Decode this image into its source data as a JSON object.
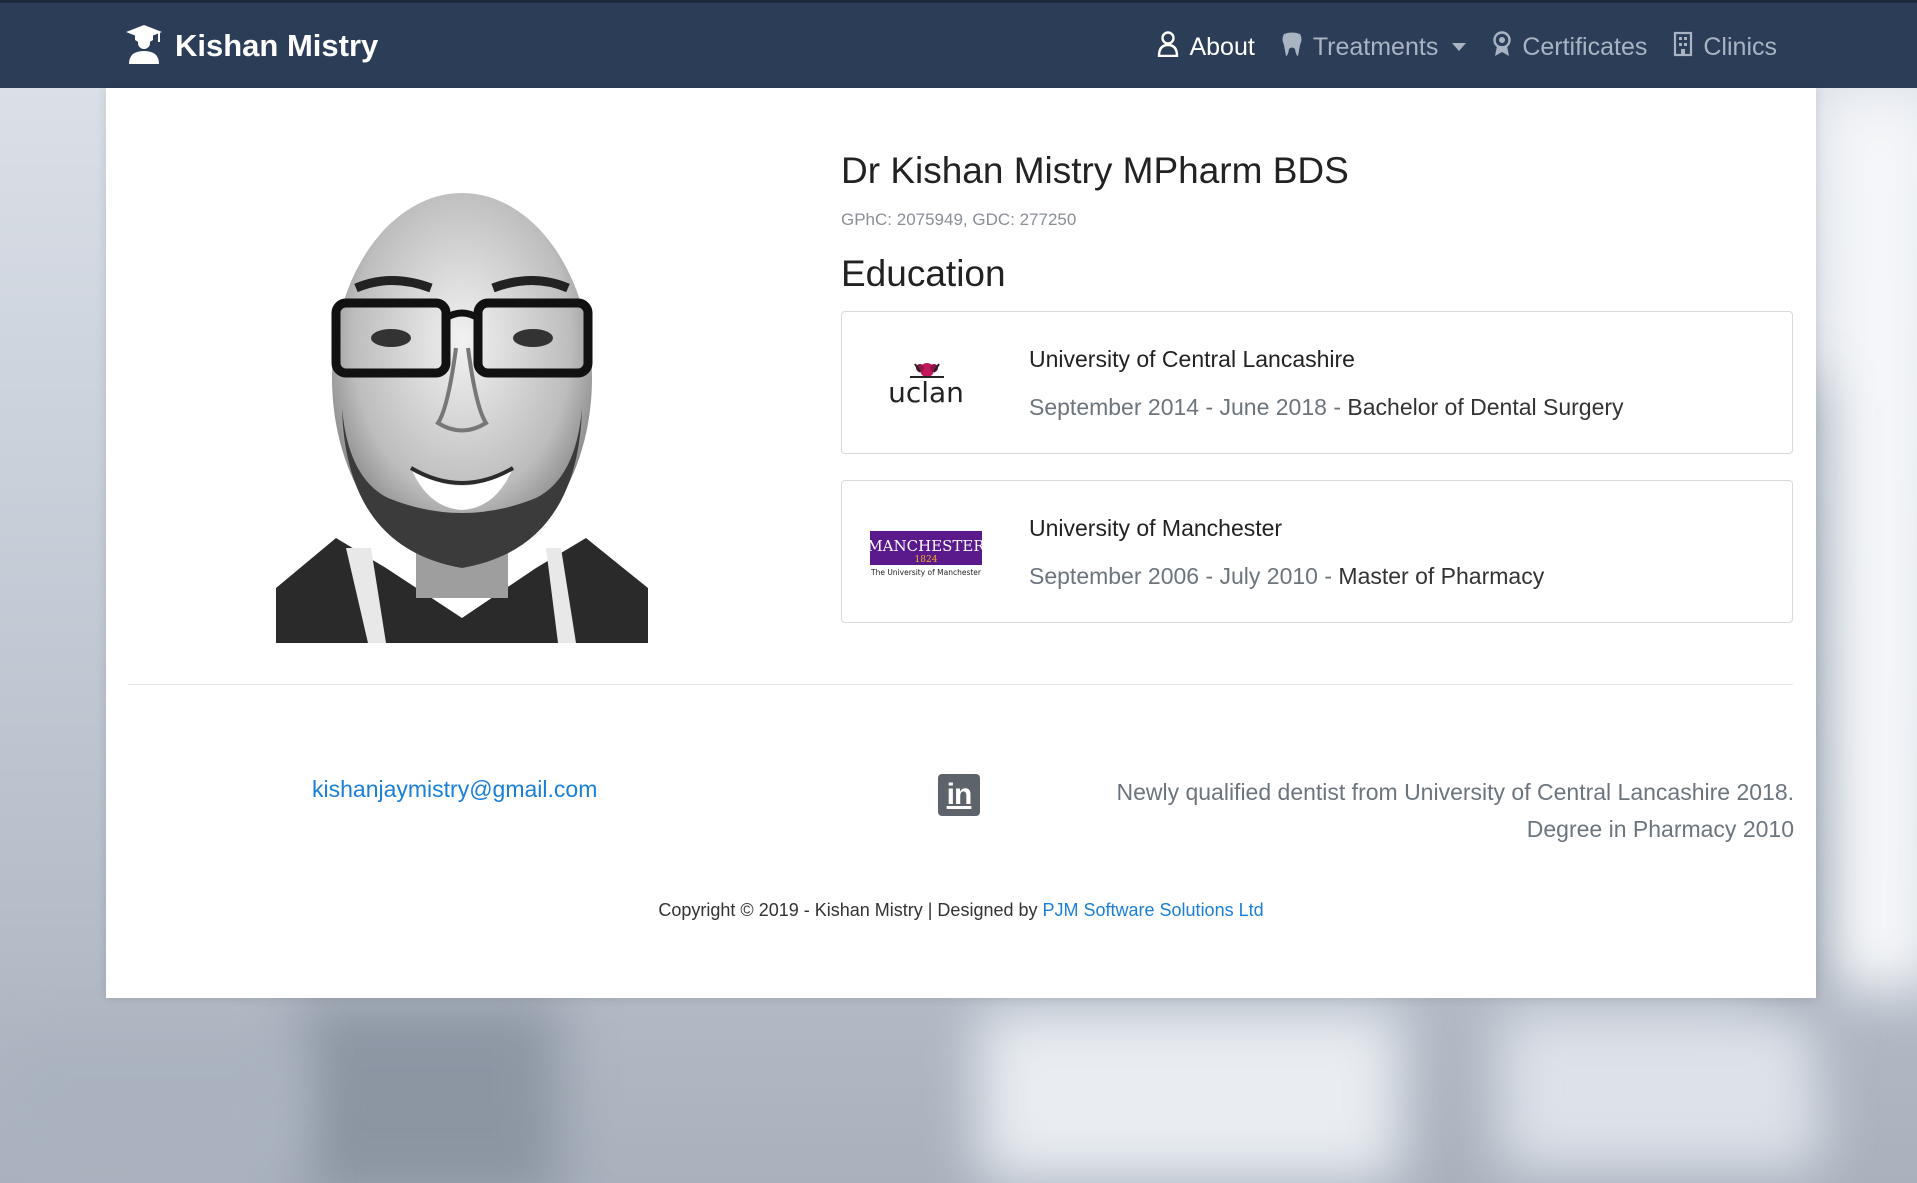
{
  "navbar": {
    "brand": "Kishan Mistry",
    "items": [
      {
        "label": "About",
        "active": true
      },
      {
        "label": "Treatments",
        "active": false
      },
      {
        "label": "Certificates",
        "active": false
      },
      {
        "label": "Clinics",
        "active": false
      }
    ]
  },
  "profile": {
    "name": "Dr Kishan Mistry MPharm BDS",
    "registration": "GPhC: 2075949, GDC: 277250"
  },
  "education": {
    "title": "Education",
    "entries": [
      {
        "institution": "University of Central Lancashire",
        "dates": "September 2014 - June 2018",
        "separator": " - ",
        "degree": "Bachelor of Dental Surgery",
        "logo_text": "uclan"
      },
      {
        "institution": "University of Manchester",
        "dates": "September 2006 - July 2010",
        "separator": " - ",
        "degree": "Master of Pharmacy",
        "logo_text": "MANCHESTER",
        "logo_year": "1824",
        "logo_sub": "The University of Manchester"
      }
    ]
  },
  "footer": {
    "email": "kishanjaymistry@gmail.com",
    "linkedin_icon": "linkedin-icon",
    "about": "Newly qualified dentist from University of Central Lancashire 2018. Degree in Pharmacy 2010",
    "copyright_prefix": "Copyright © 2019 - Kishan Mistry | Designed by ",
    "designer": "PJM Software Solutions Ltd"
  },
  "colors": {
    "navbar": "#2c3e57",
    "link": "#1a7fd6",
    "muted": "#6c757d",
    "manchester_purple": "#5a1a8c",
    "manchester_gold": "#f3b21b"
  }
}
